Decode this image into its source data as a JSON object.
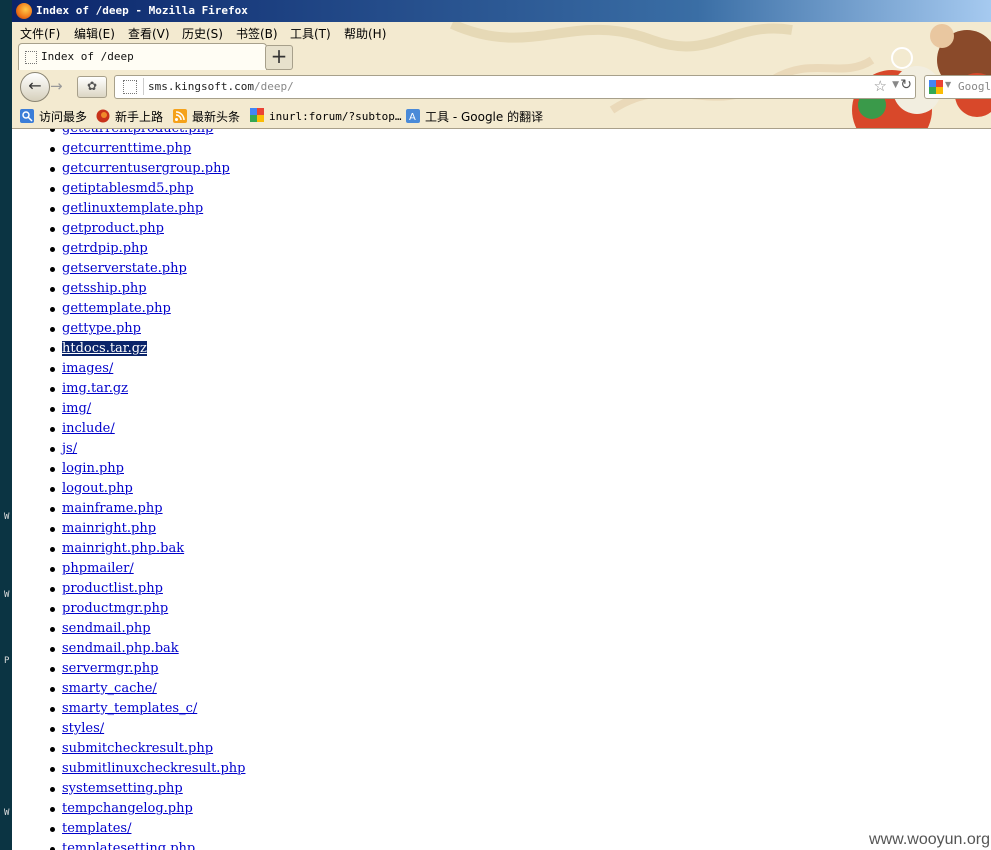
{
  "window": {
    "title": "Index of /deep - Mozilla Firefox"
  },
  "menu": [
    "文件(F)",
    "编辑(E)",
    "查看(V)",
    "历史(S)",
    "书签(B)",
    "工具(T)",
    "帮助(H)"
  ],
  "tab": {
    "label": "Index of /deep"
  },
  "newtab_symbol": "+",
  "nav": {
    "back_symbol": "←",
    "forward_symbol": "→",
    "addons_symbol": "✿"
  },
  "url": {
    "host": "sms.kingsoft.com",
    "path": "/deep/"
  },
  "search": {
    "placeholder": "Googl"
  },
  "bookmarks": [
    "访问最多",
    "新手上路",
    "最新头条",
    "inurl:forum/?subtop…",
    "工具 - Google 的翻译"
  ],
  "files": [
    "getcurrentproduct.php",
    "getcurrenttime.php",
    "getcurrentusergroup.php",
    "getiptablesmd5.php",
    "getlinuxtemplate.php",
    "getproduct.php",
    "getrdpip.php",
    "getserverstate.php",
    "getsship.php",
    "gettemplate.php",
    "gettype.php",
    "htdocs.tar.gz",
    "images/",
    "img.tar.gz",
    "img/",
    "include/",
    "js/",
    "login.php",
    "logout.php",
    "mainframe.php",
    "mainright.php",
    "mainright.php.bak",
    "phpmailer/",
    "productlist.php",
    "productmgr.php",
    "sendmail.php",
    "sendmail.php.bak",
    "servermgr.php",
    "smarty_cache/",
    "smarty_templates_c/",
    "styles/",
    "submitcheckresult.php",
    "submitlinuxcheckresult.php",
    "systemsetting.php",
    "tempchangelog.php",
    "templates/",
    "templatesetting.php"
  ],
  "selected_file": "htdocs.tar.gz",
  "left_strip_letters": [
    "W",
    "W",
    "P",
    "W"
  ],
  "watermark": "www.wooyun.org",
  "colors": {
    "link": "#0000cc",
    "selection": "#0a246a",
    "titlebar": "#0a246a"
  }
}
